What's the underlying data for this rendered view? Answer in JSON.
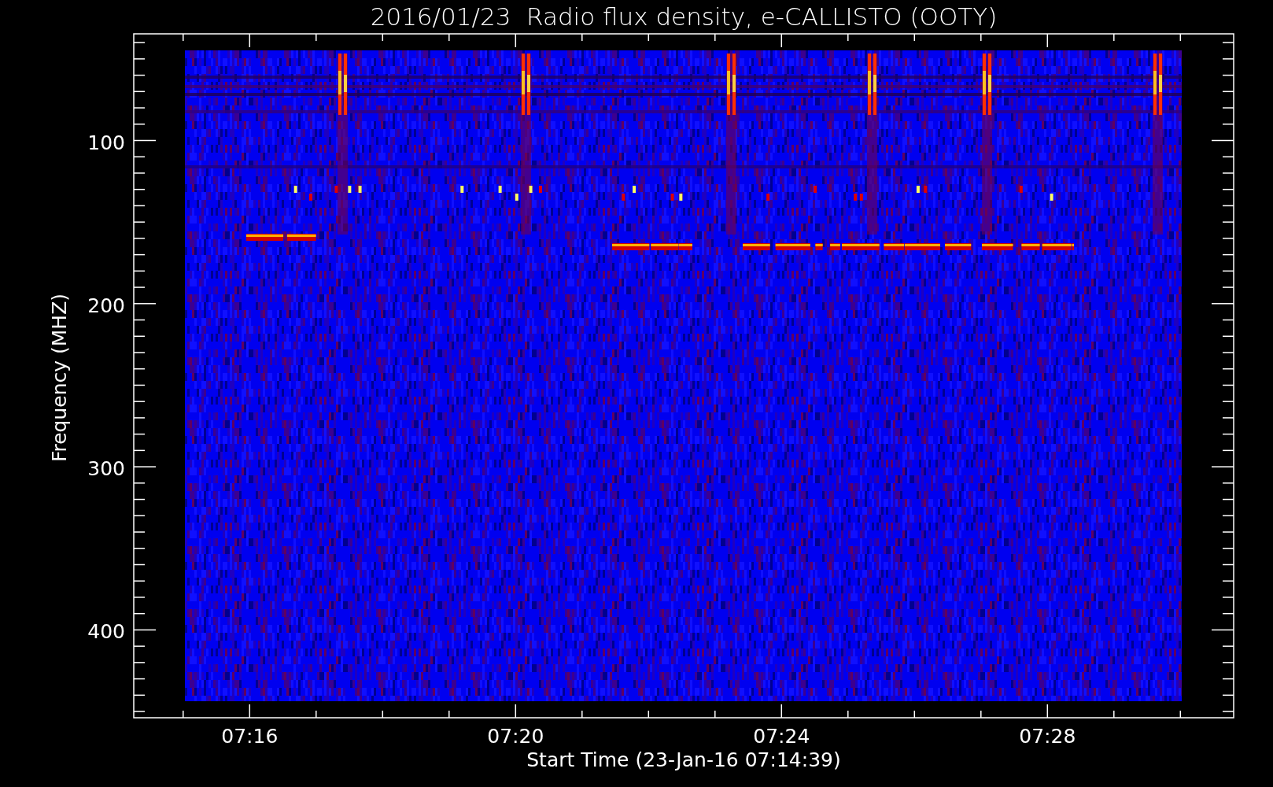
{
  "title": "2016/01/23  Radio flux density, e-CALLISTO (OOTY)",
  "y_axis": {
    "label": "Frequency (MHZ)",
    "ticks": [
      "100",
      "200",
      "300",
      "400"
    ]
  },
  "x_axis": {
    "label": "Start Time (23-Jan-16 07:14:39)",
    "ticks": [
      "07:16",
      "07:20",
      "07:24",
      "07:28"
    ]
  }
}
